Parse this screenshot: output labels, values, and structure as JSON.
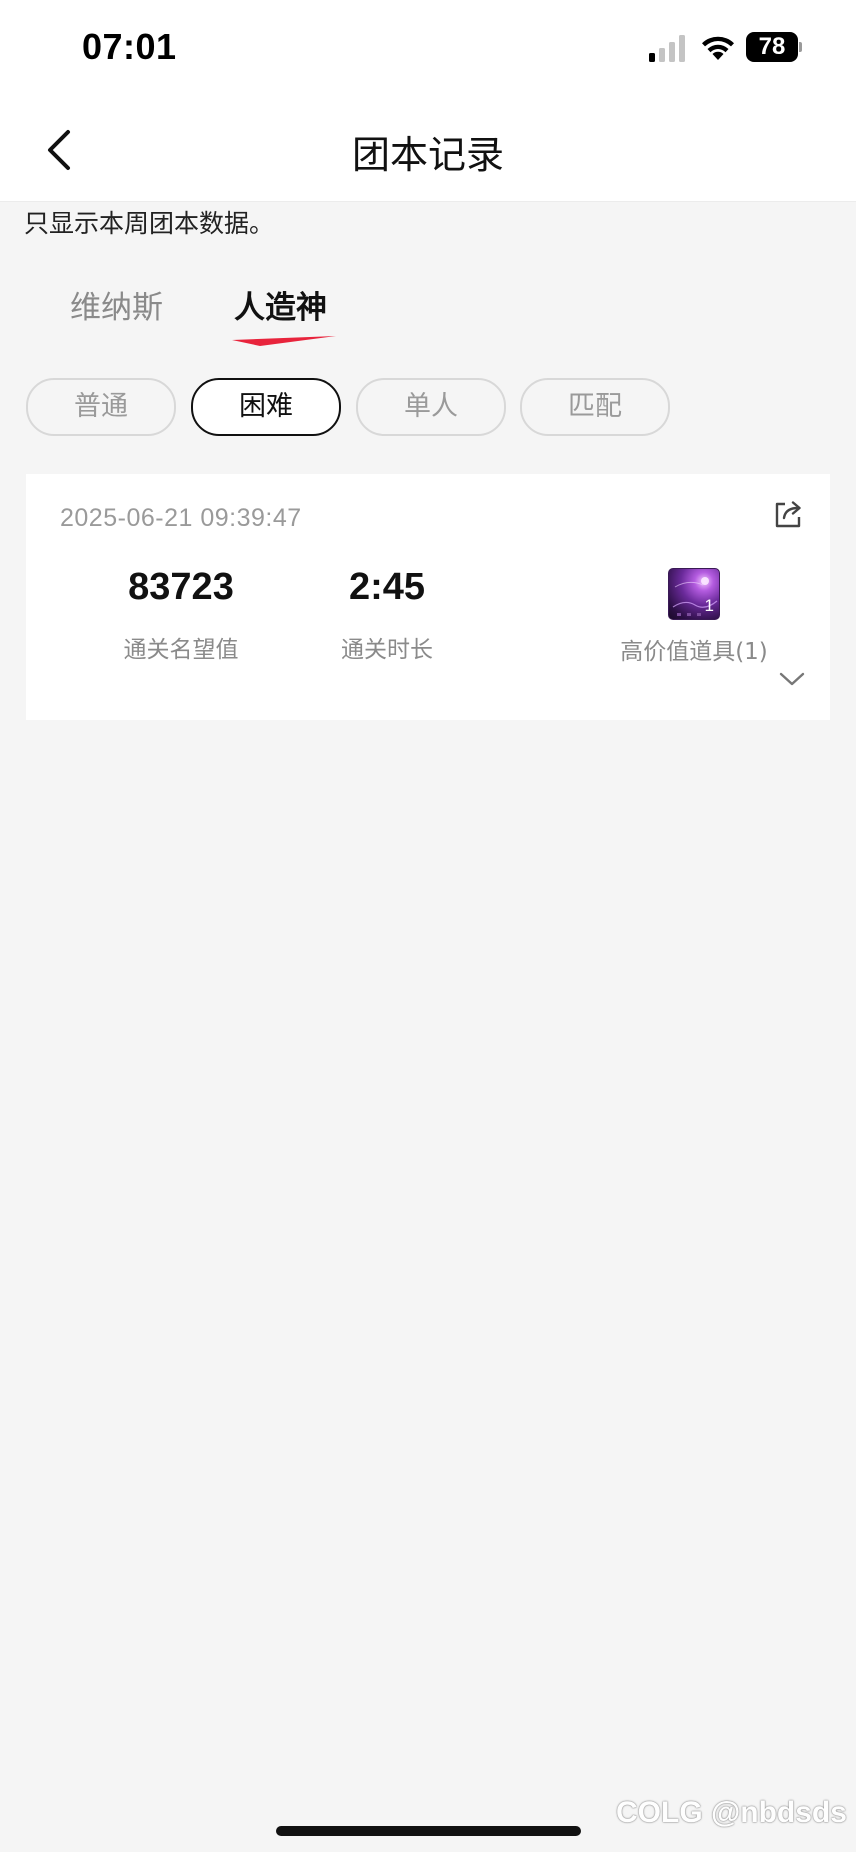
{
  "status_bar": {
    "time": "07:01",
    "battery": "78"
  },
  "nav": {
    "title": "团本记录"
  },
  "notice": "只显示本周团本数据。",
  "tabs": [
    {
      "label": "维纳斯",
      "active": false
    },
    {
      "label": "人造神",
      "active": true
    }
  ],
  "difficulty": [
    {
      "label": "普通",
      "active": false
    },
    {
      "label": "困难",
      "active": true
    },
    {
      "label": "单人",
      "active": false
    },
    {
      "label": "匹配",
      "active": false
    }
  ],
  "record": {
    "date": "2025-06-21 09:39:47",
    "reputation_value": "83723",
    "reputation_label": "通关名望值",
    "time_value": "2:45",
    "time_label": "通关时长",
    "item_count": "1",
    "item_label": "高价值道具(1)"
  },
  "watermark": "COLG @nbdsds",
  "colors": {
    "accent": "#e8243c",
    "background": "#f5f5f5"
  }
}
